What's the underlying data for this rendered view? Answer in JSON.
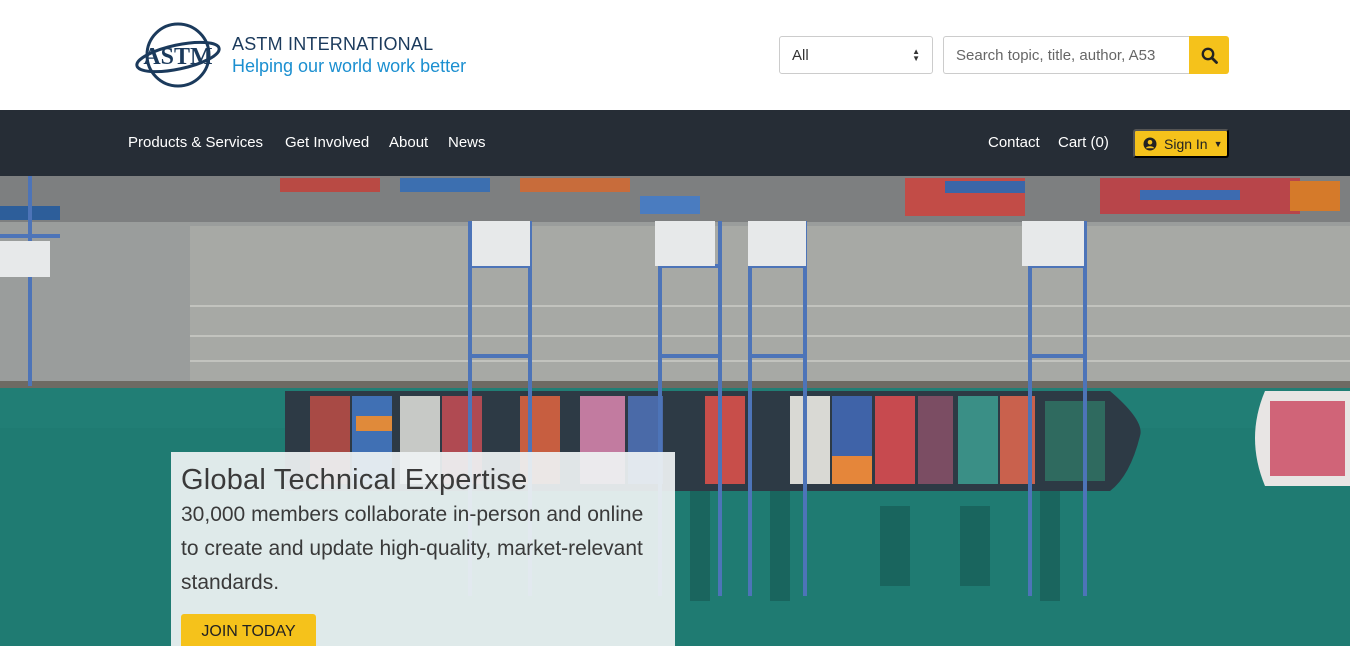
{
  "header": {
    "logo_mark_text": "ASTM",
    "logo_name": "ASTM INTERNATIONAL",
    "logo_tagline": "Helping our world work better",
    "search": {
      "scope_value": "All",
      "placeholder": "Search topic, title, author, A53"
    }
  },
  "nav": {
    "left_items": [
      "Products & Services",
      "Get Involved",
      "About",
      "News"
    ],
    "contact_label": "Contact",
    "cart_label": "Cart (0)",
    "signin_label": "Sign In"
  },
  "hero": {
    "title": "Global Technical Expertise",
    "body": "30,000 members collaborate in-person and online to create and update high-quality, market-relevant standards.",
    "cta_label": "JOIN TODAY"
  },
  "colors": {
    "accent_yellow": "#f5c21b",
    "nav_bg": "#262d36",
    "brand_navy": "#1b3a5c",
    "brand_blue": "#1b8fd0",
    "sea": "#1f7a72"
  },
  "icons": {
    "search_button": "search-icon",
    "signin": "user-circle-icon",
    "signin_caret": "caret-down-icon",
    "select_arrows": "sort-arrows-icon"
  }
}
